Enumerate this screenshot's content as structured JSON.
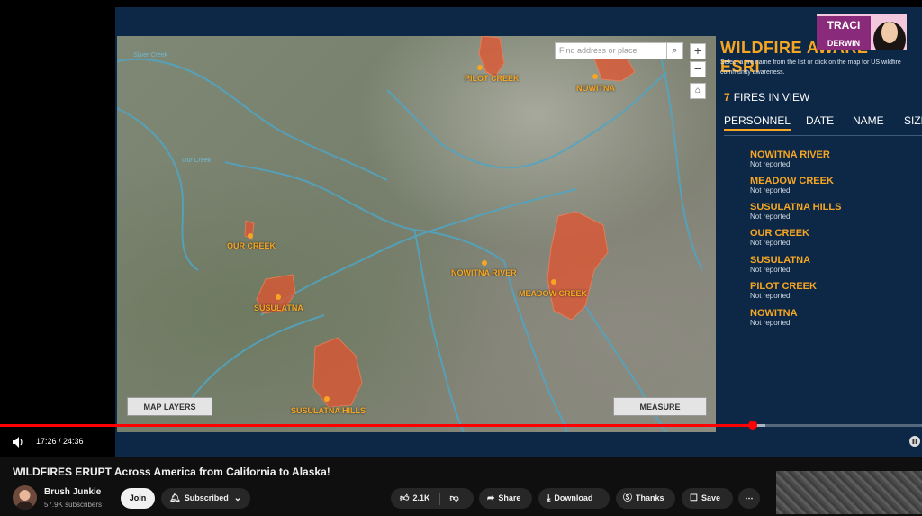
{
  "map": {
    "search_placeholder": "Find address or place",
    "search_icon": "search-icon",
    "zoom_in": "+",
    "zoom_out": "−",
    "home_icon": "home-icon",
    "map_layers_label": "MAP LAYERS",
    "measure_label": "MEASURE",
    "fire_labels": {
      "pilot_creek": "PILOT CREEK",
      "nowitna": "NOWITNA",
      "our_creek": "OUR CREEK",
      "nowitna_river": "NOWITNA RIVER",
      "meadow_creek": "MEADOW CREEK",
      "susulatna": "SUSULATNA",
      "susulatna_hills": "SUSULATNA HILLS"
    },
    "river_labels": {
      "silver_creek": "Silver Creek",
      "our_creek": "Our Creek"
    },
    "colors": {
      "fire_label": "#f6a623",
      "fire_area": "#e2542f",
      "river": "#4fa6c5"
    }
  },
  "panel": {
    "title": "WILDFIRE AWARE - ESRI",
    "description": "Select a fire name from the list or click on the map for US wildfire community awareness.",
    "fires_count": "7",
    "fires_label": "FIRES IN VIEW",
    "sort_tabs": [
      "PERSONNEL",
      "DATE",
      "NAME",
      "SIZE"
    ],
    "fires": [
      {
        "name": "NOWITNA RIVER",
        "status": "Not reported"
      },
      {
        "name": "MEADOW CREEK",
        "status": "Not reported"
      },
      {
        "name": "SUSULATNA HILLS",
        "status": "Not reported"
      },
      {
        "name": "OUR CREEK",
        "status": "Not reported"
      },
      {
        "name": "SUSULATNA",
        "status": "Not reported"
      },
      {
        "name": "PILOT CREEK",
        "status": "Not reported"
      },
      {
        "name": "NOWITNA",
        "status": "Not reported"
      }
    ]
  },
  "overlay": {
    "name_line1": "TRACI",
    "name_line2": "DERWIN"
  },
  "player": {
    "current_time": "17:26",
    "duration": "24:36",
    "time_display": "17:26 / 24:36",
    "progress": 0.816,
    "buffered": 0.83
  },
  "video": {
    "title": "WILDFIRES ERUPT Across America from California to Alaska!",
    "channel_name": "Brush Junkie",
    "subscribers": "57.9K subscribers",
    "join_label": "Join",
    "subscribed_label": "Subscribed",
    "like_count": "2.1K",
    "share_label": "Share",
    "download_label": "Download",
    "thanks_label": "Thanks",
    "save_label": "Save"
  }
}
